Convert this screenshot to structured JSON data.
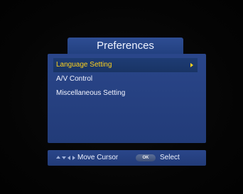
{
  "window": {
    "title": "Preferences"
  },
  "menu": {
    "items": [
      {
        "label": "Language Setting",
        "selected": true,
        "has_submenu": true
      },
      {
        "label": "A/V Control",
        "selected": false,
        "has_submenu": false
      },
      {
        "label": "Miscellaneous Setting",
        "selected": false,
        "has_submenu": false
      }
    ]
  },
  "help_bar": {
    "move_label": "Move Cursor",
    "ok_key_label": "OK",
    "select_label": "Select",
    "nav_icons": [
      "arrow-up-icon",
      "arrow-down-icon",
      "arrow-left-icon",
      "arrow-right-icon"
    ]
  },
  "colors": {
    "panel": "#2a468a",
    "selected_text": "#ffd21c",
    "text": "#f2f4ff"
  }
}
